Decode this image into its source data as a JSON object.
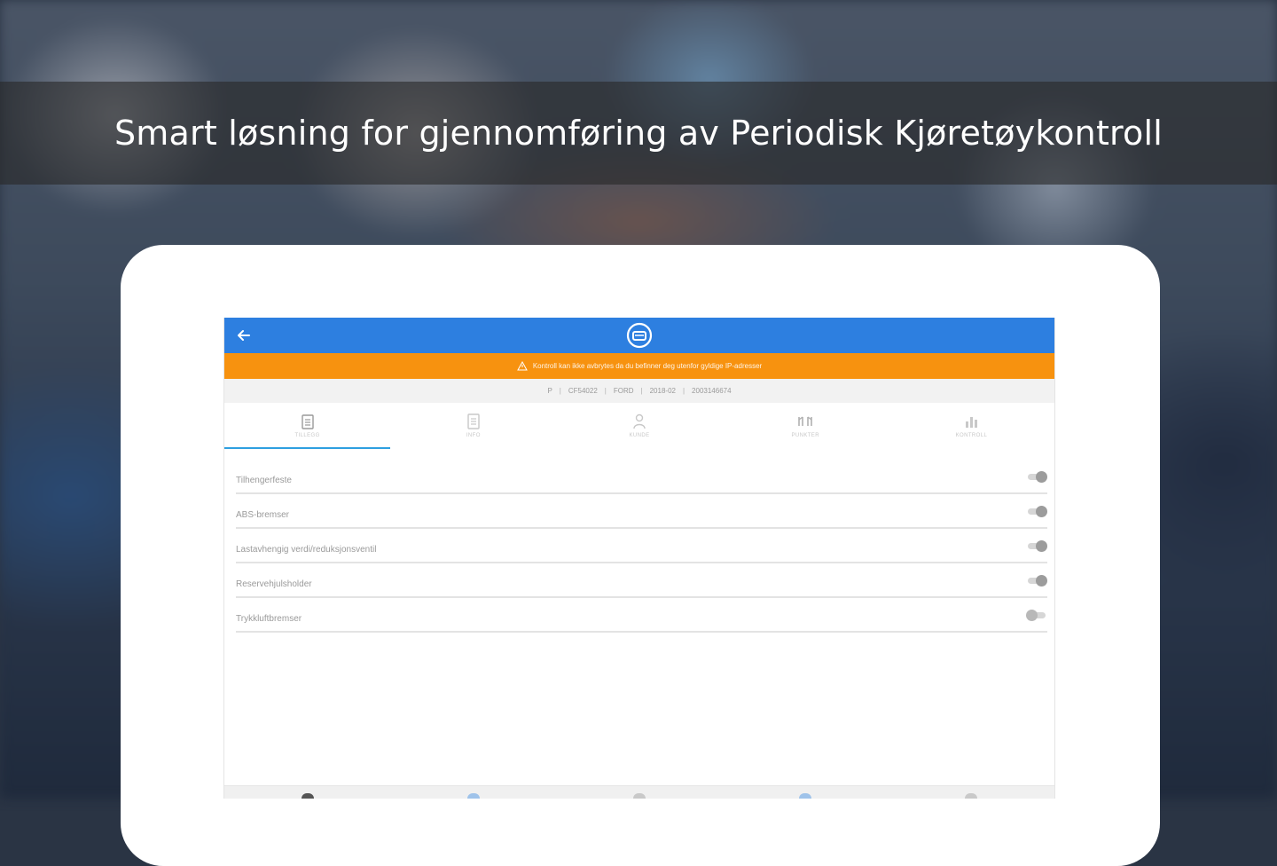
{
  "headline": "Smart løsning for gjennomføring av Periodisk Kjøretøykontroll",
  "app": {
    "warning_text": "Kontroll kan ikke avbrytes da du befinner deg utenfor gyldige IP-adresser",
    "info": [
      "P",
      "CF54022",
      "FORD",
      "2018-02",
      "2003146674"
    ],
    "tabs": [
      {
        "label": "TILLEGG",
        "icon": "clipboard-icon",
        "active": true
      },
      {
        "label": "INFO",
        "icon": "document-icon",
        "active": false
      },
      {
        "label": "KUNDE",
        "icon": "person-icon",
        "active": false
      },
      {
        "label": "PUNKTER",
        "icon": "gauge-icon",
        "active": false
      },
      {
        "label": "KONTROLL",
        "icon": "bar-chart-icon",
        "active": false
      }
    ],
    "rows": [
      {
        "label": "Tilhengerfeste",
        "on": true
      },
      {
        "label": "ABS-bremser",
        "on": true
      },
      {
        "label": "Lastavhengig verdi/reduksjonsventil",
        "on": true
      },
      {
        "label": "Reservehjulsholder",
        "on": true
      },
      {
        "label": "Trykkluftbremser",
        "on": false
      }
    ]
  },
  "colors": {
    "app_bar": "#2d7fe0",
    "warning_bar": "#f7920f",
    "tab_indicator": "#2d9fe0"
  }
}
